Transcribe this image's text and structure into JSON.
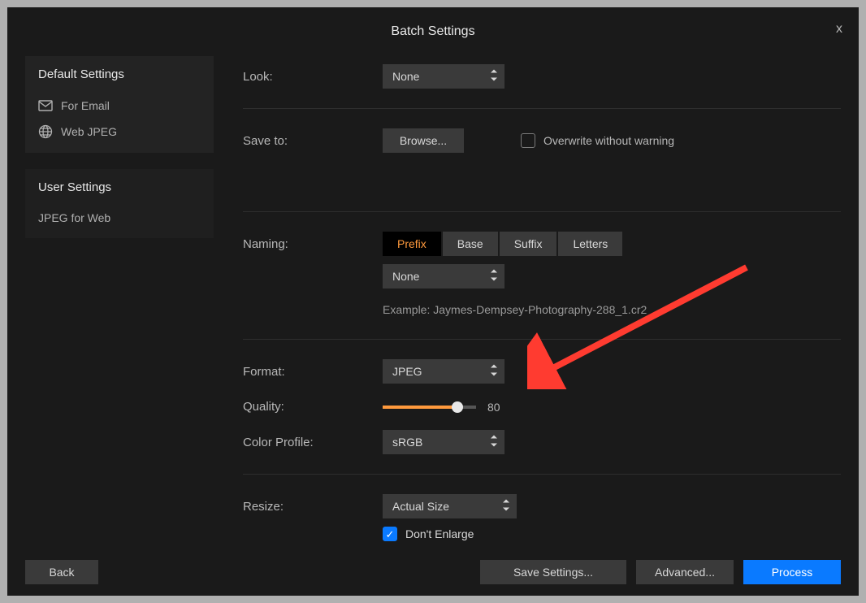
{
  "title": "Batch Settings",
  "close": "x",
  "sidebar": {
    "default_heading": "Default Settings",
    "items": [
      {
        "label": "For Email"
      },
      {
        "label": "Web JPEG"
      }
    ],
    "user_heading": "User Settings",
    "user_items": [
      {
        "label": "JPEG for Web"
      }
    ]
  },
  "labels": {
    "look": "Look:",
    "save_to": "Save to:",
    "naming": "Naming:",
    "format": "Format:",
    "quality": "Quality:",
    "color_profile": "Color Profile:",
    "resize": "Resize:"
  },
  "look_value": "None",
  "browse": "Browse...",
  "overwrite": "Overwrite without warning",
  "naming_tabs": [
    "Prefix",
    "Base",
    "Suffix",
    "Letters"
  ],
  "naming_value": "None",
  "example_prefix": "Example: ",
  "example_value": "Jaymes-Dempsey-Photography-288_1.cr2",
  "format_value": "JPEG",
  "quality_value": "80",
  "quality_percent": 80,
  "color_profile_value": "sRGB",
  "resize_value": "Actual Size",
  "dont_enlarge": "Don't Enlarge",
  "footer": {
    "back": "Back",
    "save_settings": "Save Settings...",
    "advanced": "Advanced...",
    "process": "Process"
  }
}
